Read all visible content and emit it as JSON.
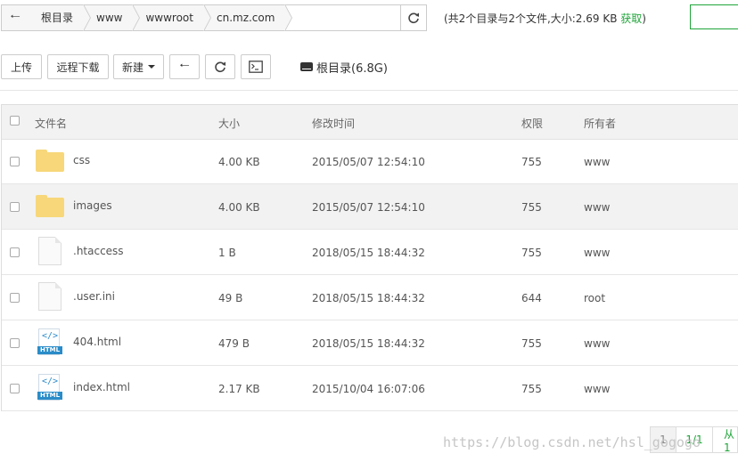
{
  "path_bar": {
    "crumbs": [
      "根目录",
      "www",
      "wwwroot",
      "cn.mz.com"
    ]
  },
  "summary": {
    "prefix": "(共2个目录与2个文件,大小:2.69 KB ",
    "link": "获取",
    "suffix": ")"
  },
  "toolbar": {
    "upload": "上传",
    "remote_download": "远程下载",
    "new": "新建",
    "root_label": "根目录(6.8G)"
  },
  "table": {
    "headers": {
      "name": "文件名",
      "size": "大小",
      "modified": "修改时间",
      "perm": "权限",
      "owner": "所有者"
    },
    "rows": [
      {
        "name": "css",
        "size": "4.00 KB",
        "modified": "2015/05/07 12:54:10",
        "perm": "755",
        "owner": "www",
        "type": "folder"
      },
      {
        "name": "images",
        "size": "4.00 KB",
        "modified": "2015/05/07 12:54:10",
        "perm": "755",
        "owner": "www",
        "type": "folder"
      },
      {
        "name": ".htaccess",
        "size": "1 B",
        "modified": "2018/05/15 18:44:32",
        "perm": "755",
        "owner": "www",
        "type": "file"
      },
      {
        "name": ".user.ini",
        "size": "49 B",
        "modified": "2018/05/15 18:44:32",
        "perm": "644",
        "owner": "root",
        "type": "file"
      },
      {
        "name": "404.html",
        "size": "479 B",
        "modified": "2018/05/15 18:44:32",
        "perm": "755",
        "owner": "www",
        "type": "html"
      },
      {
        "name": "index.html",
        "size": "2.17 KB",
        "modified": "2015/10/04 16:07:06",
        "perm": "755",
        "owner": "www",
        "type": "html"
      }
    ]
  },
  "pager": {
    "page": "1",
    "total": "1/1",
    "from": "从1"
  },
  "watermark": "https://blog.csdn.net/hsl_gogogo",
  "icons": {
    "back": "arrow-left-icon",
    "refresh": "refresh-icon",
    "terminal": "terminal-icon",
    "disk": "hard-drive-icon"
  },
  "colors": {
    "accent": "#20a53a",
    "folder": "#f7d77a",
    "html_badge": "#2a8cc8"
  }
}
